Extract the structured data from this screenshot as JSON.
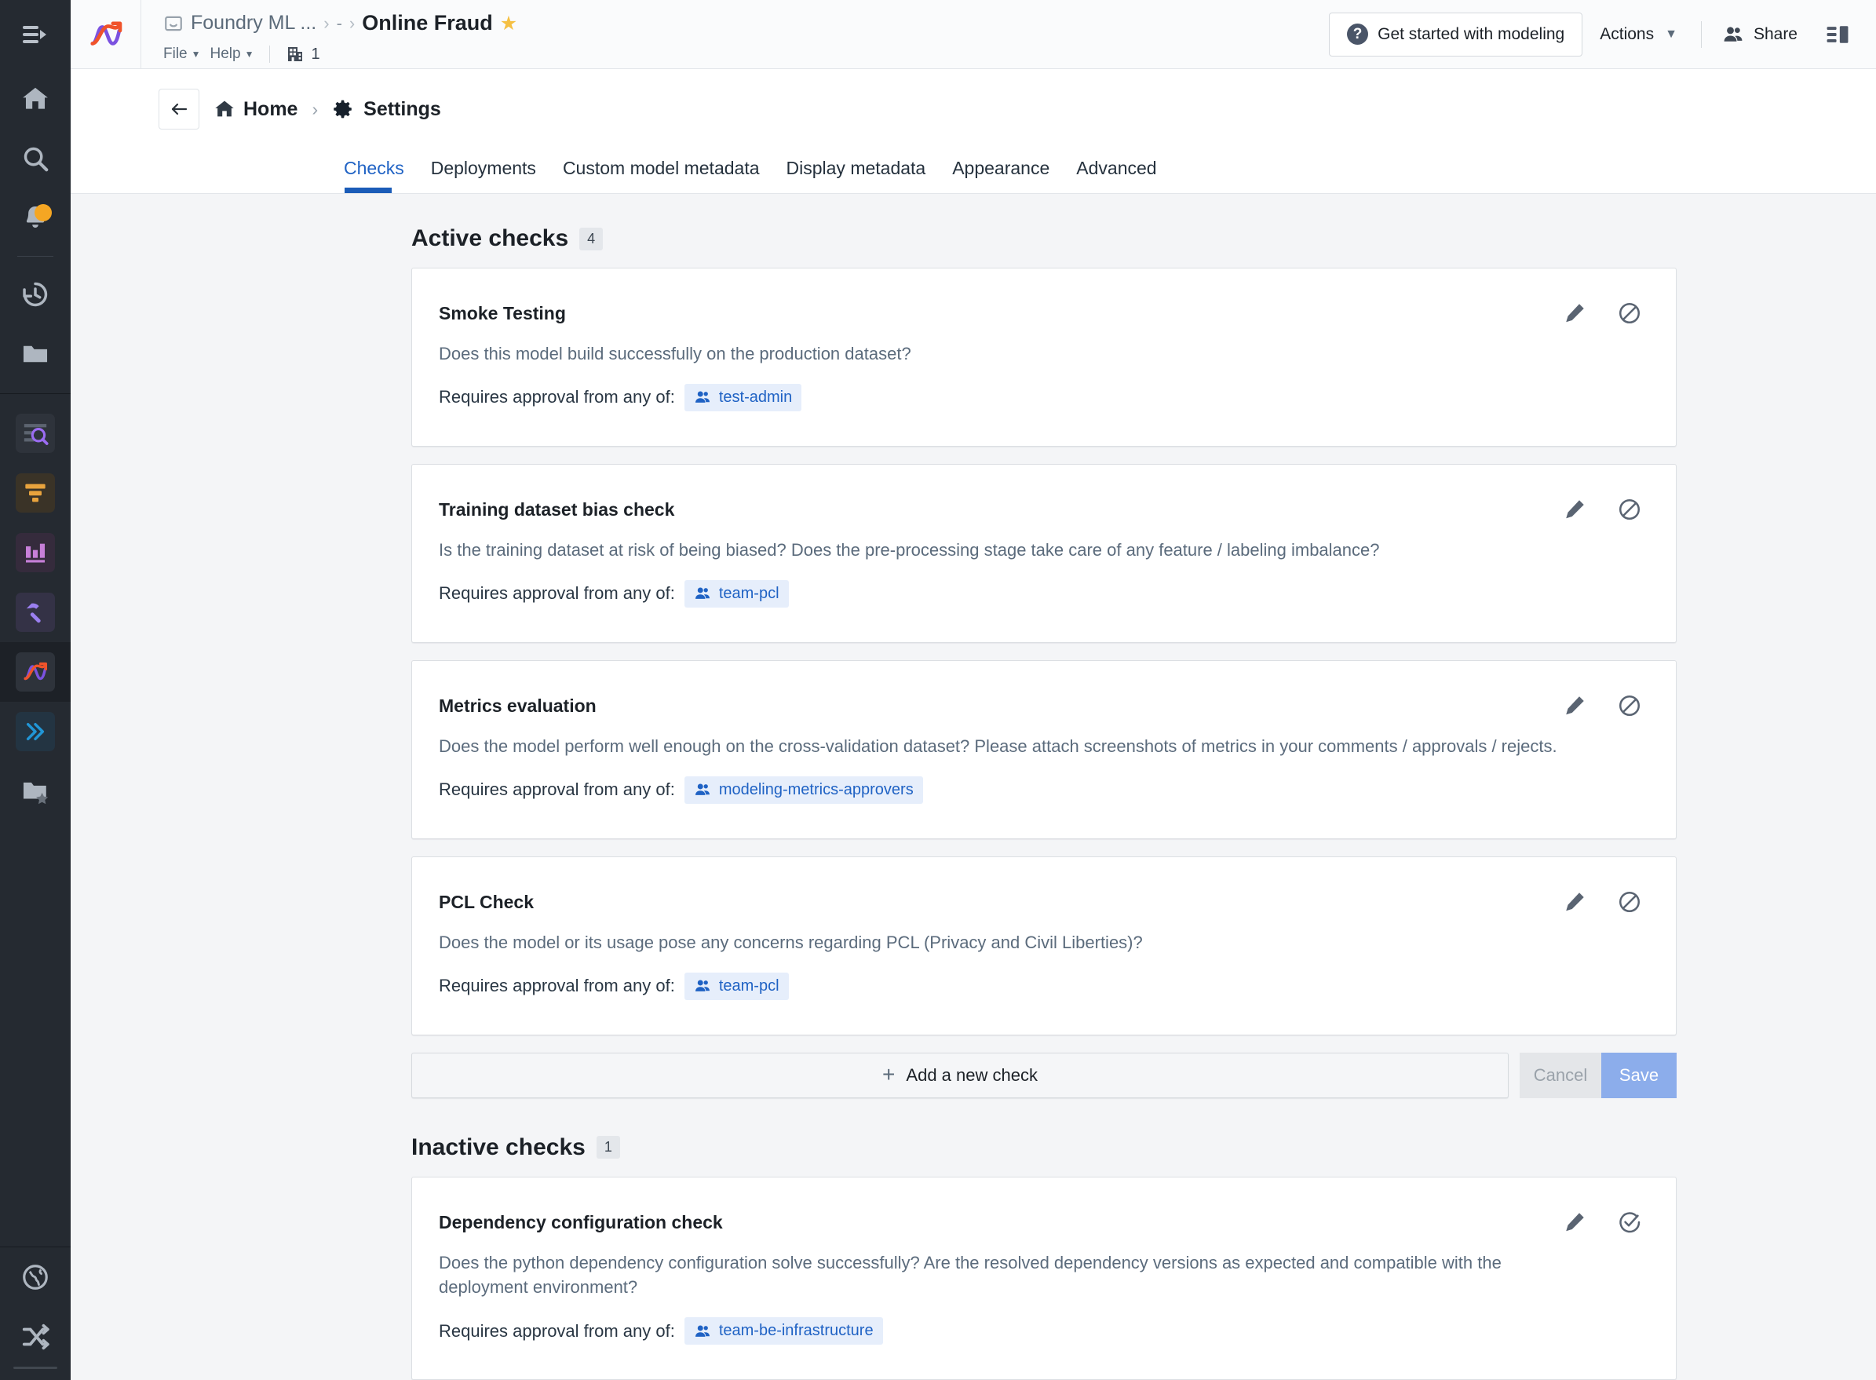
{
  "rail": {
    "toggle_icon": "sidebar-expand-icon",
    "items": [
      {
        "icon": "home-icon",
        "name": "home"
      },
      {
        "icon": "search-icon",
        "name": "search"
      },
      {
        "icon": "bell-icon",
        "name": "notifications",
        "badge": true
      },
      {
        "icon": "history-icon",
        "name": "recent"
      },
      {
        "icon": "folder-icon",
        "name": "files"
      },
      {
        "icon": "data-search-icon",
        "name": "object-explorer"
      },
      {
        "icon": "funnel-icon",
        "name": "pipeline-builder"
      },
      {
        "icon": "bar-chart-icon",
        "name": "quiver"
      },
      {
        "icon": "hammer-icon",
        "name": "code-workbook"
      },
      {
        "icon": "modeling-curve-icon",
        "name": "modeling",
        "selected": true
      },
      {
        "icon": "double-chevron-icon",
        "name": "workflows"
      },
      {
        "icon": "folder-star-icon",
        "name": "favorites"
      },
      {
        "icon": "globe-icon",
        "name": "language"
      },
      {
        "icon": "shuffle-icon",
        "name": "shuffle"
      }
    ]
  },
  "header": {
    "logo_icon": "modeling-logo-icon",
    "breadcrumb_parent": "Foundry ML ...",
    "breadcrumb_dash": "-",
    "title": "Online Fraud",
    "star_icon": "star-filled-icon",
    "menus": [
      {
        "label": "File"
      },
      {
        "label": "Help"
      }
    ],
    "org_icon": "organization-icon",
    "org_count": "1",
    "get_started_label": "Get started with modeling",
    "get_started_icon": "help-circle-icon",
    "actions_label": "Actions",
    "share_label": "Share",
    "share_icon": "people-icon",
    "panel_icon": "right-panel-toggle-icon"
  },
  "subheader": {
    "back_icon": "arrow-left-icon",
    "home_label": "Home",
    "home_icon": "home-icon",
    "separator": "›",
    "settings_label": "Settings",
    "settings_icon": "gear-icon"
  },
  "tabs": [
    {
      "label": "Checks",
      "active": true
    },
    {
      "label": "Deployments",
      "active": false
    },
    {
      "label": "Custom model metadata",
      "active": false
    },
    {
      "label": "Display metadata",
      "active": false
    },
    {
      "label": "Appearance",
      "active": false
    },
    {
      "label": "Advanced",
      "active": false
    }
  ],
  "active_section": {
    "title": "Active checks",
    "count": "4",
    "approval_prefix": "Requires approval from any of:",
    "checks": [
      {
        "title": "Smoke Testing",
        "description": "Does this model build successfully on the production dataset?",
        "approvers": [
          "test-admin"
        ],
        "edit_icon": "pencil-icon",
        "toggle_icon": "disable-circle-slash-icon"
      },
      {
        "title": "Training dataset bias check",
        "description": "Is the training dataset at risk of being biased? Does the pre-processing stage take care of any feature / labeling imbalance?",
        "approvers": [
          "team-pcl"
        ],
        "edit_icon": "pencil-icon",
        "toggle_icon": "disable-circle-slash-icon"
      },
      {
        "title": "Metrics evaluation",
        "description": "Does the model perform well enough on the cross-validation dataset? Please attach screenshots of metrics in your comments / approvals / rejects.",
        "approvers": [
          "modeling-metrics-approvers"
        ],
        "edit_icon": "pencil-icon",
        "toggle_icon": "disable-circle-slash-icon"
      },
      {
        "title": "PCL Check",
        "description": "Does the model or its usage pose any concerns regarding PCL (Privacy and Civil Liberties)?",
        "approvers": [
          "team-pcl"
        ],
        "edit_icon": "pencil-icon",
        "toggle_icon": "disable-circle-slash-icon"
      }
    ]
  },
  "footer_actions": {
    "add_label": "Add a new check",
    "add_icon": "plus-icon",
    "cancel_label": "Cancel",
    "save_label": "Save"
  },
  "inactive_section": {
    "title": "Inactive checks",
    "count": "1",
    "approval_prefix": "Requires approval from any of:",
    "checks": [
      {
        "title": "Dependency configuration check",
        "description": "Does the python dependency configuration solve successfully? Are the resolved dependency versions as expected and compatible with the deployment environment?",
        "approvers": [
          "team-be-infrastructure"
        ],
        "edit_icon": "pencil-icon",
        "toggle_icon": "enable-circle-check-icon"
      }
    ]
  },
  "colors": {
    "accent_blue": "#1f62c4",
    "tab_indicator": "#1b5cb8",
    "rail_bg": "#252a31",
    "page_bg": "#f4f5f7",
    "chip_bg": "#e6eefb",
    "save_btn": "#8cadeb",
    "star": "#f5c043",
    "badge": "#f5a623"
  }
}
